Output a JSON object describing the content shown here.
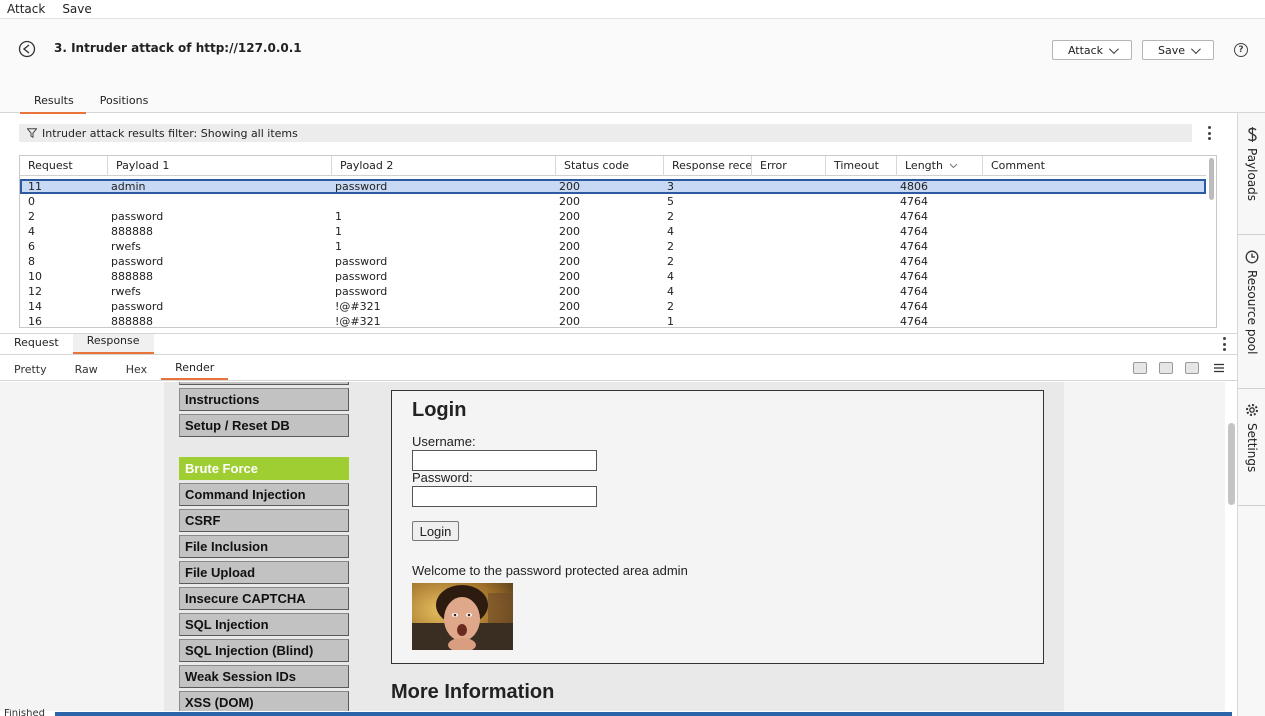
{
  "menubar": {
    "items": [
      "Attack",
      "Save"
    ]
  },
  "header": {
    "title": "3. Intruder attack of http://127.0.0.1",
    "attack_button": "Attack",
    "save_button": "Save",
    "tabs": [
      "Results",
      "Positions"
    ],
    "active_tab": "Results"
  },
  "side_panel": {
    "items": [
      "Payloads",
      "Resource pool",
      "Settings"
    ]
  },
  "filter": {
    "text": "Intruder attack results filter: Showing all items"
  },
  "table": {
    "columns": [
      "Request",
      "Payload 1",
      "Payload 2",
      "Status code",
      "Response recei...",
      "Error",
      "Timeout",
      "Length",
      "Comment"
    ],
    "sorted_column": "Length",
    "selected_row": 0,
    "rows": [
      [
        "11",
        "admin",
        "password",
        "200",
        "3",
        "",
        "",
        "4806",
        ""
      ],
      [
        "0",
        "",
        "",
        "200",
        "5",
        "",
        "",
        "4764",
        ""
      ],
      [
        "2",
        "password",
        "1",
        "200",
        "2",
        "",
        "",
        "4764",
        ""
      ],
      [
        "4",
        "888888",
        "1",
        "200",
        "4",
        "",
        "",
        "4764",
        ""
      ],
      [
        "6",
        "rwefs",
        "1",
        "200",
        "2",
        "",
        "",
        "4764",
        ""
      ],
      [
        "8",
        "password",
        "password",
        "200",
        "2",
        "",
        "",
        "4764",
        ""
      ],
      [
        "10",
        "888888",
        "password",
        "200",
        "4",
        "",
        "",
        "4764",
        ""
      ],
      [
        "12",
        "rwefs",
        "password",
        "200",
        "4",
        "",
        "",
        "4764",
        ""
      ],
      [
        "14",
        "password",
        "!@#321",
        "200",
        "2",
        "",
        "",
        "4764",
        ""
      ],
      [
        "16",
        "888888",
        "!@#321",
        "200",
        "1",
        "",
        "",
        "4764",
        ""
      ]
    ]
  },
  "message_tabs": {
    "items": [
      "Request",
      "Response"
    ],
    "active": "Response"
  },
  "view_tabs": {
    "items": [
      "Pretty",
      "Raw",
      "Hex",
      "Render"
    ],
    "active": "Render"
  },
  "render": {
    "menu": [
      "Instructions",
      "Setup / Reset DB",
      "Brute Force",
      "Command Injection",
      "CSRF",
      "File Inclusion",
      "File Upload",
      "Insecure CAPTCHA",
      "SQL Injection",
      "SQL Injection (Blind)",
      "Weak Session IDs",
      "XSS (DOM)"
    ],
    "active_menu": "Brute Force",
    "login_heading": "Login",
    "username_label": "Username:",
    "password_label": "Password:",
    "login_button": "Login",
    "welcome_text": "Welcome to the password protected area admin",
    "more_heading": "More Information"
  },
  "status": {
    "text": "Finished",
    "progress": 1.0
  },
  "colors": {
    "accent": "#e8743b",
    "selected_row": "#c7d9f4",
    "active_menu": "#9fce32",
    "progress": "#2b64a8"
  }
}
